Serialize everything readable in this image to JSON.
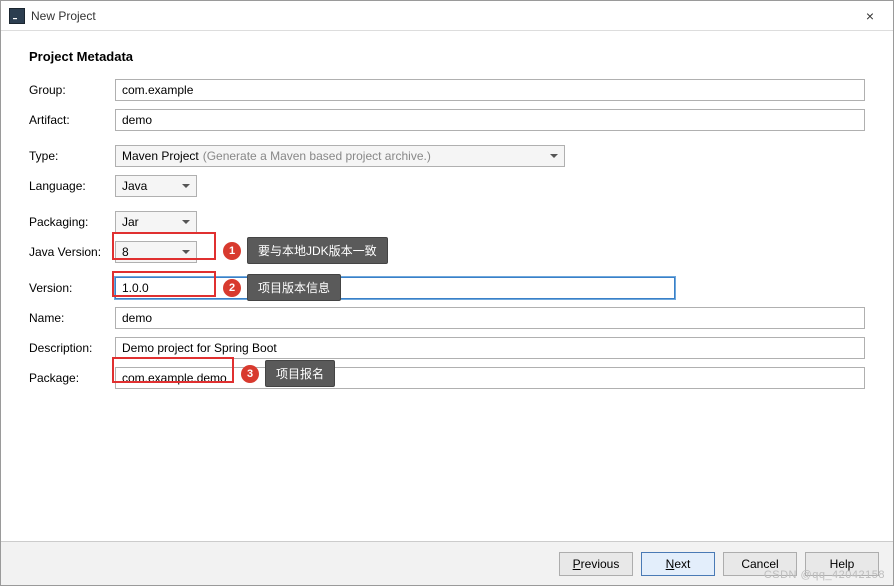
{
  "window": {
    "title": "New Project",
    "close_icon": "×"
  },
  "section": {
    "title": "Project Metadata"
  },
  "labels": {
    "group": "Group:",
    "artifact": "Artifact:",
    "type": "Type:",
    "language": "Language:",
    "packaging": "Packaging:",
    "java_version": "Java Version:",
    "version": "Version:",
    "name": "Name:",
    "description": "Description:",
    "package": "Package:"
  },
  "values": {
    "group": "com.example",
    "artifact": "demo",
    "type": "Maven Project",
    "type_hint": "(Generate a Maven based project archive.)",
    "language": "Java",
    "packaging": "Jar",
    "java_version": "8",
    "version": "1.0.0",
    "name": "demo",
    "description": "Demo project for Spring Boot",
    "package": "com.example.demo"
  },
  "annotations": {
    "a1": {
      "num": "1",
      "text": "要与本地JDK版本一致"
    },
    "a2": {
      "num": "2",
      "text": "项目版本信息"
    },
    "a3": {
      "num": "3",
      "text": "项目报名"
    }
  },
  "footer": {
    "previous": "Previous",
    "next": "Next",
    "cancel": "Cancel",
    "help": "Help"
  },
  "watermark": "CSDN @qq_42042158"
}
